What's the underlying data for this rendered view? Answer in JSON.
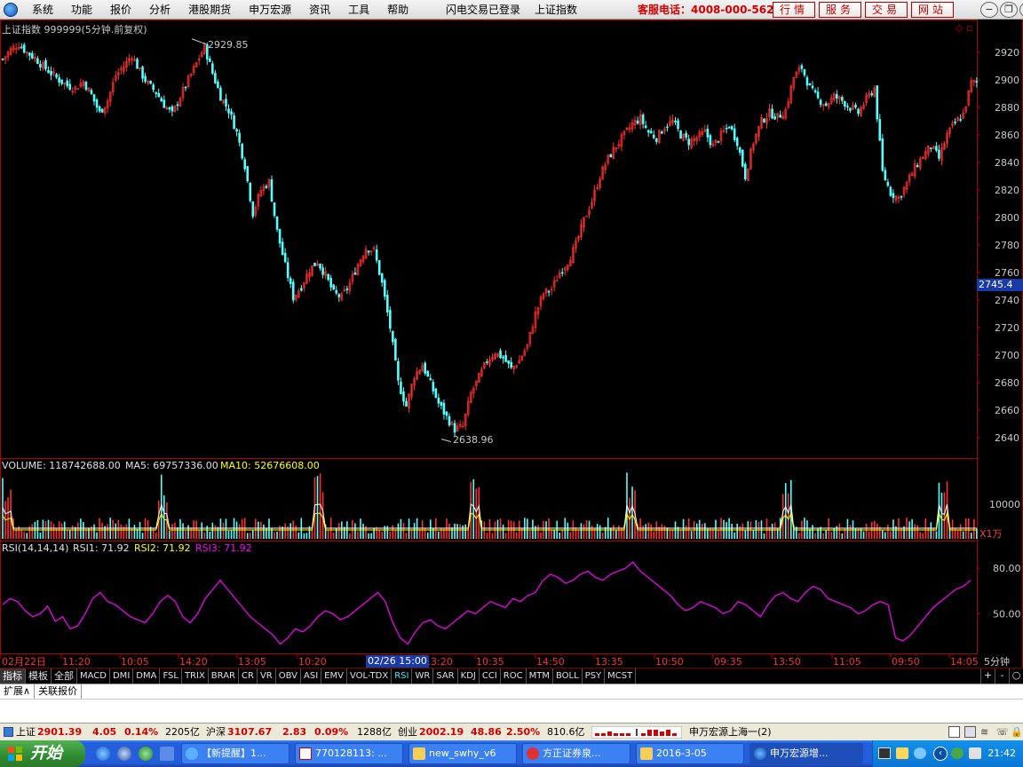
{
  "menu": {
    "items": [
      "系统",
      "功能",
      "报价",
      "分析",
      "港股期货",
      "申万宏源",
      "资讯",
      "工具",
      "帮助"
    ],
    "center": [
      "闪电交易已登录",
      "上证指数"
    ],
    "hotline": "客服电话：4008-000-562",
    "quick_buttons": [
      "行情",
      "服务",
      "交易",
      "网站"
    ]
  },
  "chart": {
    "title": "上证指数 999999(5分钟.前复权)",
    "max_label": "2929.85",
    "min_label": "2638.96",
    "current_price": "2745.4",
    "volume_header": {
      "label": "VOLUME: 118742688.00",
      "ma5": "MA5: 69757336.00",
      "ma10": "MA10: 52676608.00"
    },
    "volume_axis_label": "10000",
    "volume_unit": "X1万",
    "rsi_header": {
      "label": "RSI(14,14,14)",
      "rsi1": "RSI1: 71.92",
      "rsi2": "RSI2: 71.92",
      "rsi3": "RSI3: 71.92"
    },
    "period_label": "5分钟",
    "highlighted_date": "02/26 15:00",
    "colors": {
      "up": "#ff3030",
      "down": "#54ffff",
      "ma5": "#ffffff",
      "ma10": "#ffff00",
      "rsi": "#ff00ff",
      "grid": "#b00000",
      "price_tag": "#1a3aa8"
    }
  },
  "chart_data": [
    {
      "type": "candlestick",
      "title": "上证指数 999999(5分钟.前复权)",
      "ylim": [
        2630,
        2935
      ],
      "yticks": [
        2640,
        2660,
        2680,
        2700,
        2720,
        2740,
        2760,
        2780,
        2800,
        2820,
        2840,
        2860,
        2880,
        2900,
        2920
      ],
      "x_ticks": [
        "02月22日",
        "11:20",
        "10:05",
        "14:20",
        "13:05",
        "10:20",
        "13:20",
        "10:35",
        "14:50",
        "13:35",
        "10:50",
        "09:35",
        "13:50",
        "11:05",
        "09:50",
        "14:05"
      ],
      "close_path": [
        [
          0,
          2915
        ],
        [
          3,
          2922
        ],
        [
          6,
          2926
        ],
        [
          9,
          2920
        ],
        [
          12,
          2916
        ],
        [
          15,
          2910
        ],
        [
          18,
          2905
        ],
        [
          21,
          2900
        ],
        [
          24,
          2896
        ],
        [
          27,
          2894
        ],
        [
          30,
          2899
        ],
        [
          33,
          2889
        ],
        [
          36,
          2876
        ],
        [
          39,
          2885
        ],
        [
          42,
          2903
        ],
        [
          45,
          2910
        ],
        [
          48,
          2918
        ],
        [
          51,
          2906
        ],
        [
          54,
          2897
        ],
        [
          57,
          2891
        ],
        [
          60,
          2882
        ],
        [
          63,
          2875
        ],
        [
          66,
          2888
        ],
        [
          69,
          2900
        ],
        [
          72,
          2912
        ],
        [
          75,
          2924
        ],
        [
          78,
          2905
        ],
        [
          81,
          2888
        ],
        [
          84,
          2878
        ],
        [
          87,
          2862
        ],
        [
          90,
          2838
        ],
        [
          93,
          2803
        ],
        [
          96,
          2820
        ],
        [
          99,
          2826
        ],
        [
          102,
          2790
        ],
        [
          105,
          2765
        ],
        [
          108,
          2742
        ],
        [
          111,
          2750
        ],
        [
          114,
          2762
        ],
        [
          117,
          2768
        ],
        [
          120,
          2758
        ],
        [
          123,
          2745
        ],
        [
          126,
          2742
        ],
        [
          129,
          2752
        ],
        [
          132,
          2766
        ],
        [
          135,
          2778
        ],
        [
          138,
          2776
        ],
        [
          141,
          2752
        ],
        [
          144,
          2720
        ],
        [
          147,
          2680
        ],
        [
          150,
          2663
        ],
        [
          153,
          2685
        ],
        [
          156,
          2693
        ],
        [
          159,
          2679
        ],
        [
          162,
          2665
        ],
        [
          165,
          2655
        ],
        [
          168,
          2646
        ],
        [
          171,
          2648
        ],
        [
          174,
          2672
        ],
        [
          177,
          2684
        ],
        [
          180,
          2696
        ],
        [
          183,
          2702
        ],
        [
          186,
          2698
        ],
        [
          189,
          2690
        ],
        [
          192,
          2696
        ],
        [
          195,
          2707
        ],
        [
          198,
          2730
        ],
        [
          201,
          2745
        ],
        [
          204,
          2748
        ],
        [
          207,
          2760
        ],
        [
          210,
          2768
        ],
        [
          213,
          2780
        ],
        [
          216,
          2798
        ],
        [
          219,
          2812
        ],
        [
          222,
          2830
        ],
        [
          225,
          2843
        ],
        [
          228,
          2852
        ],
        [
          231,
          2860
        ],
        [
          234,
          2868
        ],
        [
          237,
          2872
        ],
        [
          240,
          2862
        ],
        [
          243,
          2858
        ],
        [
          246,
          2866
        ],
        [
          249,
          2870
        ],
        [
          252,
          2860
        ],
        [
          255,
          2855
        ],
        [
          258,
          2858
        ],
        [
          261,
          2862
        ],
        [
          264,
          2852
        ],
        [
          267,
          2860
        ],
        [
          270,
          2867
        ],
        [
          273,
          2855
        ],
        [
          276,
          2830
        ],
        [
          279,
          2855
        ],
        [
          282,
          2870
        ],
        [
          285,
          2876
        ],
        [
          288,
          2873
        ],
        [
          291,
          2878
        ],
        [
          294,
          2902
        ],
        [
          297,
          2909
        ],
        [
          300,
          2894
        ],
        [
          303,
          2886
        ],
        [
          306,
          2882
        ],
        [
          309,
          2888
        ],
        [
          312,
          2885
        ],
        [
          315,
          2880
        ],
        [
          318,
          2876
        ],
        [
          321,
          2886
        ],
        [
          324,
          2894
        ],
        [
          327,
          2833
        ],
        [
          330,
          2818
        ],
        [
          333,
          2814
        ],
        [
          336,
          2825
        ],
        [
          339,
          2836
        ],
        [
          342,
          2845
        ],
        [
          345,
          2852
        ],
        [
          348,
          2843
        ],
        [
          351,
          2860
        ],
        [
          354,
          2869
        ],
        [
          357,
          2875
        ],
        [
          360,
          2898
        ]
      ]
    },
    {
      "type": "bar",
      "title": "VOLUME",
      "ylabel": "X1万",
      "yticks": [
        10000
      ],
      "series": [
        {
          "name": "MA5",
          "values": []
        },
        {
          "name": "MA10",
          "values": []
        }
      ]
    },
    {
      "type": "line",
      "title": "RSI(14,14,14)",
      "ylim": [
        25,
        90
      ],
      "yticks": [
        50.0,
        80.0
      ],
      "values": [
        56,
        60,
        58,
        52,
        48,
        50,
        55,
        45,
        48,
        40,
        42,
        50,
        60,
        64,
        58,
        56,
        52,
        48,
        46,
        44,
        50,
        58,
        62,
        58,
        48,
        44,
        50,
        60,
        66,
        72,
        66,
        60,
        54,
        48,
        44,
        40,
        36,
        30,
        34,
        40,
        38,
        42,
        48,
        52,
        50,
        46,
        48,
        52,
        56,
        60,
        64,
        58,
        44,
        34,
        30,
        38,
        44,
        46,
        42,
        40,
        44,
        48,
        52,
        50,
        54,
        58,
        56,
        54,
        60,
        58,
        62,
        64,
        72,
        76,
        74,
        70,
        72,
        76,
        78,
        74,
        72,
        76,
        78,
        80,
        84,
        78,
        74,
        70,
        66,
        62,
        56,
        52,
        54,
        58,
        56,
        54,
        50,
        52,
        58,
        56,
        52,
        48,
        56,
        62,
        64,
        60,
        58,
        64,
        68,
        66,
        60,
        58,
        56,
        54,
        50,
        52,
        56,
        58,
        56,
        34,
        32,
        36,
        42,
        48,
        54,
        58,
        62,
        66,
        68,
        72
      ]
    }
  ],
  "tabs": [
    "指标",
    "模板",
    "全部",
    "MACD",
    "DMI",
    "DMA",
    "FSL",
    "TRIX",
    "BRAR",
    "CR",
    "VR",
    "OBV",
    "ASI",
    "EMV",
    "VOL-TDX",
    "RSI",
    "WR",
    "SAR",
    "KDJ",
    "CCI",
    "ROC",
    "MTM",
    "BOLL",
    "PSY",
    "MCST"
  ],
  "tab_controls": [
    "+",
    "-",
    "○"
  ],
  "expand": [
    "扩展∧",
    "关联报价"
  ],
  "status": {
    "sh": {
      "label": "上证",
      "value": "2901.39",
      "change": "4.05",
      "pct": "0.14%",
      "amount": "2205亿"
    },
    "hs": {
      "label": "沪深",
      "value": "3107.67",
      "change": "2.83",
      "pct": "0.09%",
      "amount": "1288亿"
    },
    "cy": {
      "label": "创业",
      "value": "2002.19",
      "change": "48.86",
      "pct": "2.50%",
      "amount": "810.6亿"
    },
    "server": "申万宏源上海一(2)"
  },
  "taskbar": {
    "start": "开始",
    "items": [
      "【新提醒】1...",
      "770128113: ...",
      "new_swhy_v6",
      "方正证券泉...",
      "2016-3-05",
      "申万宏源增..."
    ],
    "clock": "21:42"
  }
}
